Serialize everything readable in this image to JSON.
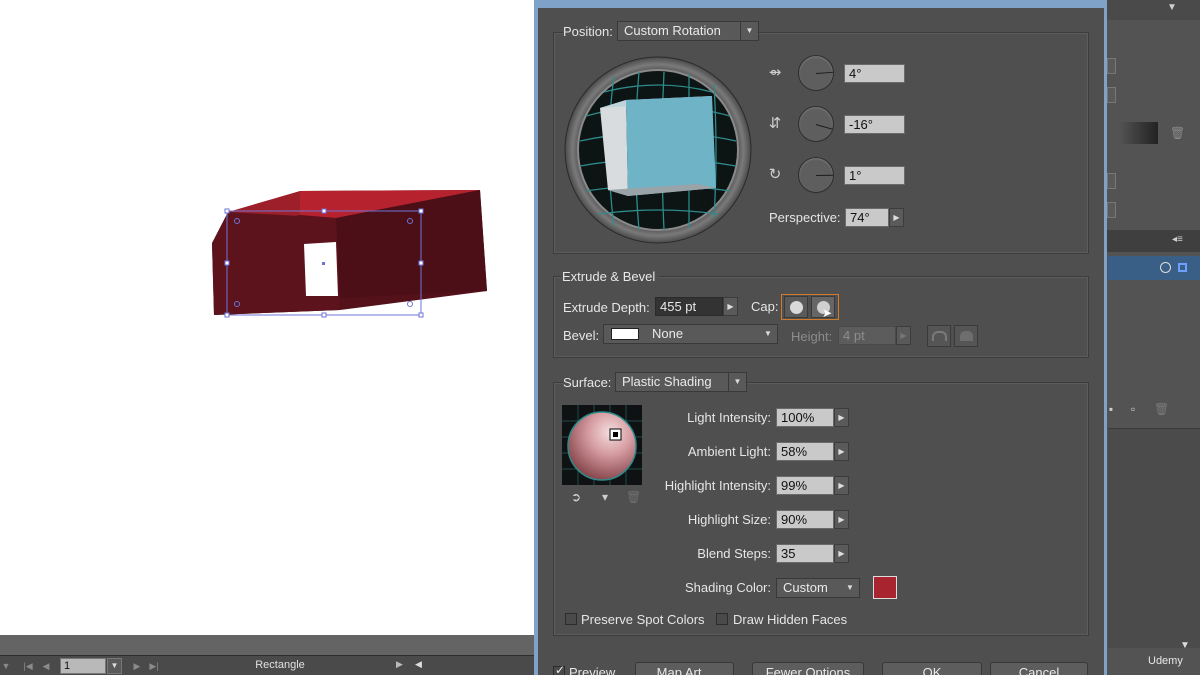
{
  "status_bar": {
    "page_number": "1",
    "label": "Rectangle"
  },
  "dialog": {
    "position": {
      "label": "Position:",
      "value": "Custom Rotation",
      "x_rotation": "4°",
      "y_rotation": "-16°",
      "z_rotation": "1°",
      "perspective_label": "Perspective:",
      "perspective_value": "74°"
    },
    "extrude_bevel": {
      "title": "Extrude & Bevel",
      "depth_label": "Extrude Depth:",
      "depth_value": "455 pt",
      "cap_label": "Cap:",
      "bevel_label": "Bevel:",
      "bevel_value": "None",
      "height_label": "Height:",
      "height_value": "4 pt"
    },
    "surface": {
      "label": "Surface:",
      "value": "Plastic Shading",
      "light_intensity_label": "Light Intensity:",
      "light_intensity_value": "100%",
      "ambient_light_label": "Ambient Light:",
      "ambient_light_value": "58%",
      "highlight_intensity_label": "Highlight Intensity:",
      "highlight_intensity_value": "99%",
      "highlight_size_label": "Highlight Size:",
      "highlight_size_value": "90%",
      "blend_steps_label": "Blend Steps:",
      "blend_steps_value": "35",
      "shading_color_label": "Shading Color:",
      "shading_color_value": "Custom",
      "shading_swatch_color": "#a8242f",
      "preserve_spot_label": "Preserve Spot Colors",
      "draw_hidden_label": "Draw Hidden Faces"
    },
    "buttons": {
      "preview": "Preview",
      "map_art": "Map Art...",
      "fewer_options": "Fewer Options",
      "ok": "OK",
      "cancel": "Cancel"
    }
  },
  "watermark": "Udemy",
  "colors": {
    "shape_dark": "#5a1219",
    "shape_light": "#b7222f",
    "dialog_bg": "#4f4f4f",
    "dialog_border": "#7fa2c8",
    "cube_face": "#6fb3c6"
  }
}
